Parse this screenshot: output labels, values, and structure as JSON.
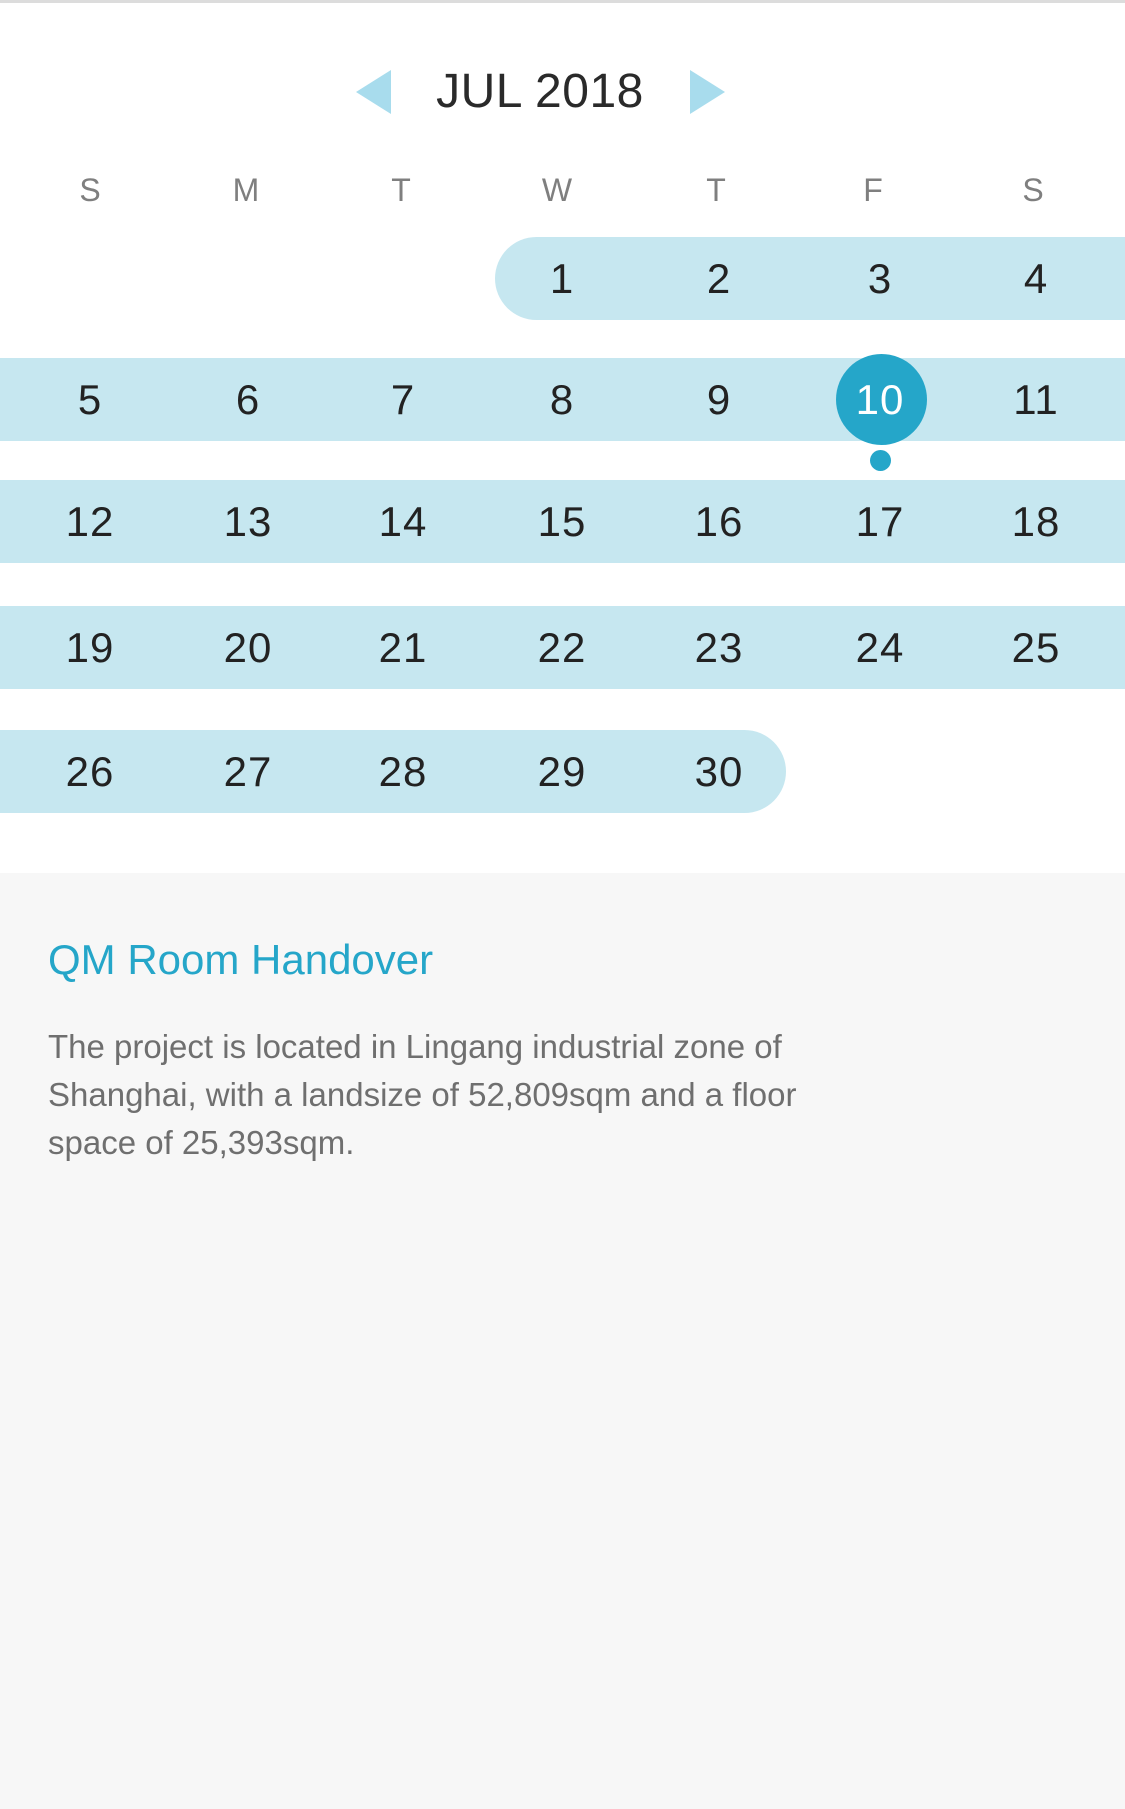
{
  "calendar": {
    "month_label": "JUL 2018",
    "prev_icon": "triangle-left-icon",
    "next_icon": "triangle-right-icon",
    "weekdays": [
      "S",
      "M",
      "T",
      "W",
      "T",
      "F",
      "S"
    ],
    "weeks": [
      [
        "",
        "",
        "",
        "1",
        "2",
        "3",
        "4"
      ],
      [
        "5",
        "6",
        "7",
        "8",
        "9",
        "10",
        "11"
      ],
      [
        "12",
        "13",
        "14",
        "15",
        "16",
        "17",
        "18"
      ],
      [
        "19",
        "20",
        "21",
        "22",
        "23",
        "24",
        "25"
      ],
      [
        "26",
        "27",
        "28",
        "29",
        "30",
        "",
        ""
      ]
    ],
    "selected_day": "10",
    "days_with_events": [
      "10"
    ],
    "colors": {
      "accent": "#25a6c9",
      "range_highlight": "#c6e7f0",
      "arrow": "#a8dced"
    }
  },
  "event": {
    "title": "QM Room Handover",
    "description": "The project is located in Lingang industrial zone of Shanghai, with a landsize of 52,809sqm and a floor space of 25,393sqm."
  }
}
